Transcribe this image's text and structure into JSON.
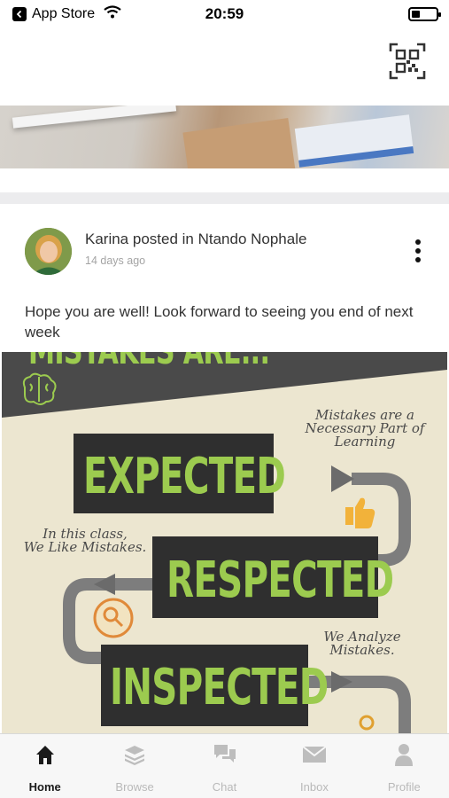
{
  "status_bar": {
    "back_app": "App Store",
    "time": "20:59"
  },
  "post": {
    "author_line": "Karina posted in Ntando Nophale",
    "time_ago": "14 days ago",
    "text": "Hope you are well! Look forward to seeing you end of next week"
  },
  "infographic": {
    "title": "MISTAKES ARE...",
    "words": [
      "EXPECTED",
      "RESPECTED",
      "INSPECTED"
    ],
    "notes": {
      "necessary": [
        "Mistakes are a",
        "Necessary Part of",
        "Learning"
      ],
      "class": [
        "In this class,",
        "We Like Mistakes."
      ],
      "analyze": [
        "We Analyze",
        "Mistakes."
      ]
    }
  },
  "tabs": [
    {
      "label": "Home",
      "icon": "home-icon",
      "active": true
    },
    {
      "label": "Browse",
      "icon": "layers-icon",
      "active": false
    },
    {
      "label": "Chat",
      "icon": "chat-icon",
      "active": false
    },
    {
      "label": "Inbox",
      "icon": "envelope-icon",
      "active": false
    },
    {
      "label": "Profile",
      "icon": "person-icon",
      "active": false
    }
  ],
  "colors": {
    "accent_green": "#9ccb4f",
    "dark_box": "#2f2f2f",
    "tab_inactive": "#b9b9b9"
  }
}
